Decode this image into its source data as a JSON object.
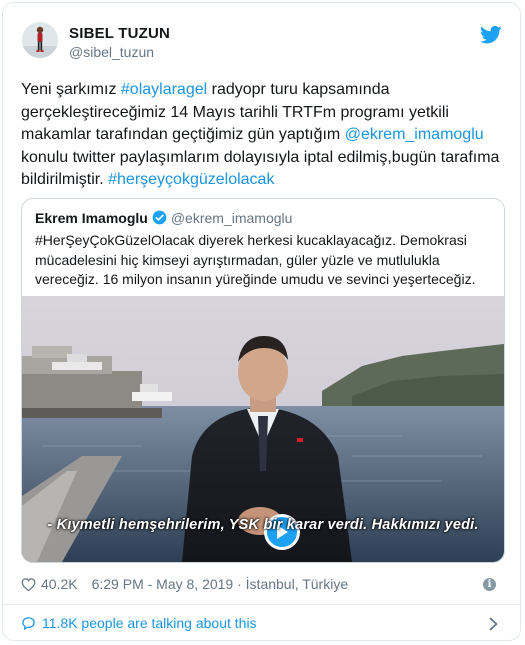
{
  "author": {
    "name": "SIBEL TUZUN",
    "handle": "@sibel_tuzun"
  },
  "tweet": {
    "segments": [
      {
        "text": "Yeni şarkımız ",
        "link": false
      },
      {
        "text": "#olaylaragel",
        "link": true
      },
      {
        "text": " radyopr turu kapsamında gerçekleştireceğimiz 14 Mayıs tarihli TRTFm programı yetkili makamlar tarafından geçtiğimiz gün yaptığım ",
        "link": false
      },
      {
        "text": "@ekrem_imamoglu",
        "link": true
      },
      {
        "text": " konulu twitter paylaşımlarım dolayısıyla iptal edilmiş,bugün tarafıma bildirilmiştir. ",
        "link": false
      },
      {
        "text": "#herşeyçokgüzelolacak",
        "link": true
      }
    ]
  },
  "quoted": {
    "name": "Ekrem Imamoglu",
    "handle": "@ekrem_imamoglu",
    "text": "#HerŞeyÇokGüzelOlacak diyerek herkesi kucaklayacağız. Demokrasi mücadelesini hiç kimseyi ayrıştırmadan, güler yüzle ve mutlulukla vereceğiz. 16 milyon insanın yüreğinde umudu ve sevinci yeşerteceğiz.",
    "video_subtitle": "- Kıymetli hemşehrilerim, YSK bir karar verdi. Hakkımızı yedi."
  },
  "meta": {
    "likes": "40.2K",
    "timestamp": "6:29 PM - May 8, 2019 · İstanbul, Türkiye"
  },
  "footer": {
    "talking": "11.8K people are talking about this"
  },
  "icons": {
    "logo": "twitter-bird-icon",
    "verified": "verified-badge-icon",
    "like": "heart-icon",
    "info": "info-icon",
    "reply": "speech-bubble-icon",
    "chevron": "chevron-right-icon",
    "play": "play-icon"
  },
  "colors": {
    "link": "#1b95e0",
    "brand": "#1da1f2",
    "secondary_text": "#657786"
  }
}
